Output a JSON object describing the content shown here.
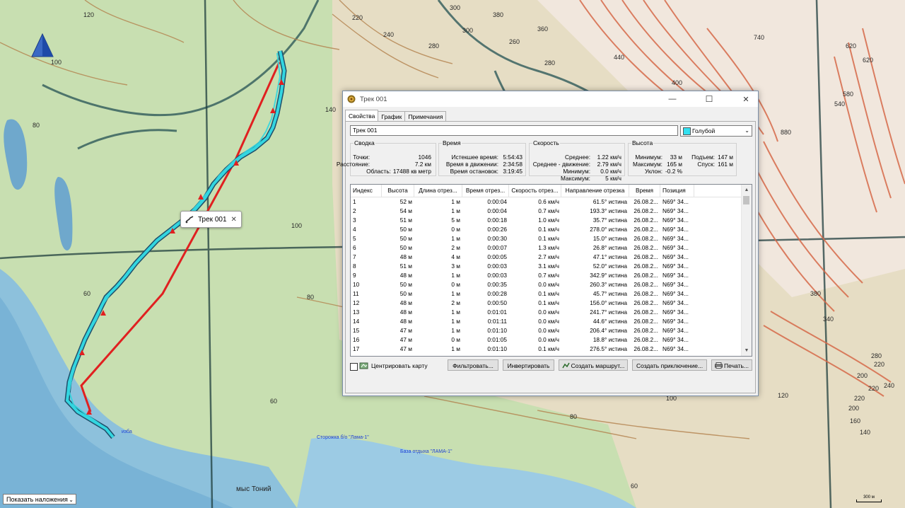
{
  "map": {
    "contour_labels": [
      "120",
      "100",
      "80",
      "60",
      "100",
      "80",
      "60",
      "140",
      "380",
      "280",
      "300",
      "240",
      "220",
      "360",
      "300",
      "260",
      "280",
      "440",
      "400",
      "740",
      "620",
      "620",
      "580",
      "880",
      "540",
      "380",
      "340",
      "280",
      "220",
      "200",
      "240",
      "220",
      "220",
      "200",
      "160",
      "140",
      "120",
      "100",
      "80",
      "60"
    ],
    "place_labels": [
      "изба",
      "Сторожка б/о \"Лама-1\"",
      "База отдыха \"ЛАМА-1\"",
      "мыс Тоний"
    ],
    "scale_label": "300 м",
    "overlay_dropdown": "Показать наложения",
    "track_popup_label": "Трек 001",
    "track_color": "#33d6e0",
    "route_color": "#e02020"
  },
  "window": {
    "title": "Трек 001",
    "tabs": [
      "Свойства",
      "График",
      "Примечания"
    ],
    "name_value": "Трек 001",
    "color_value": "Голубой",
    "color_hex": "#33e0f0",
    "summary": {
      "title": "Сводка",
      "points_label": "Точки:",
      "points_value": "1046",
      "distance_label": "Расстояние:",
      "distance_value": "7.2 км",
      "area_label": "Область:",
      "area_value": "17488 кв метр"
    },
    "time": {
      "title": "Время",
      "elapsed_label": "Истекшее время:",
      "elapsed_value": "5:54:43",
      "moving_label": "Время в движении:",
      "moving_value": "2:34:58",
      "stopped_label": "Время остановок:",
      "stopped_value": "3:19:45"
    },
    "speed": {
      "title": "Скорость",
      "avg_label": "Среднее:",
      "avg_value": "1.22 км/ч",
      "avg_moving_label": "Среднее - движение:",
      "avg_moving_value": "2.79 км/ч",
      "min_label": "Минимум:",
      "min_value": "0.0 км/ч",
      "max_label": "Максимум:",
      "max_value": "5 км/ч"
    },
    "elevation": {
      "title": "Высота",
      "min_label": "Минимум:",
      "min_value": "33 м",
      "max_label": "Максимум:",
      "max_value": "165 м",
      "grade_label": "Уклон:",
      "grade_value": "-0.2 %",
      "ascent_label": "Подъем:",
      "ascent_value": "147 м",
      "descent_label": "Спуск:",
      "descent_value": "161 м"
    },
    "table": {
      "headers": [
        "Индекс",
        "Высота",
        "Длина отрез...",
        "Время отрез...",
        "Скорость отрез...",
        "Направление отрезка",
        "Время",
        "Позиция"
      ],
      "rows": [
        [
          "1",
          "52 м",
          "1 м",
          "0:00:04",
          "0.6 км/ч",
          "61.5° истина",
          "26.08.2...",
          "N69° 34..."
        ],
        [
          "2",
          "54 м",
          "1 м",
          "0:00:04",
          "0.7 км/ч",
          "193.3° истина",
          "26.08.2...",
          "N69° 34..."
        ],
        [
          "3",
          "51 м",
          "5 м",
          "0:00:18",
          "1.0 км/ч",
          "35.7° истина",
          "26.08.2...",
          "N69° 34..."
        ],
        [
          "4",
          "50 м",
          "0 м",
          "0:00:26",
          "0.1 км/ч",
          "278.0° истина",
          "26.08.2...",
          "N69° 34..."
        ],
        [
          "5",
          "50 м",
          "1 м",
          "0:00:30",
          "0.1 км/ч",
          "15.0° истина",
          "26.08.2...",
          "N69° 34..."
        ],
        [
          "6",
          "50 м",
          "2 м",
          "0:00:07",
          "1.3 км/ч",
          "26.8° истина",
          "26.08.2...",
          "N69° 34..."
        ],
        [
          "7",
          "48 м",
          "4 м",
          "0:00:05",
          "2.7 км/ч",
          "47.1° истина",
          "26.08.2...",
          "N69° 34..."
        ],
        [
          "8",
          "51 м",
          "3 м",
          "0:00:03",
          "3.1 км/ч",
          "52.0° истина",
          "26.08.2...",
          "N69° 34..."
        ],
        [
          "9",
          "48 м",
          "1 м",
          "0:00:03",
          "0.7 км/ч",
          "342.9° истина",
          "26.08.2...",
          "N69° 34..."
        ],
        [
          "10",
          "50 м",
          "0 м",
          "0:00:35",
          "0.0 км/ч",
          "260.3° истина",
          "26.08.2...",
          "N69° 34..."
        ],
        [
          "11",
          "50 м",
          "1 м",
          "0:00:28",
          "0.1 км/ч",
          "45.7° истина",
          "26.08.2...",
          "N69° 34..."
        ],
        [
          "12",
          "48 м",
          "2 м",
          "0:00:50",
          "0.1 км/ч",
          "156.0° истина",
          "26.08.2...",
          "N69° 34..."
        ],
        [
          "13",
          "48 м",
          "1 м",
          "0:01:01",
          "0.0 км/ч",
          "241.7° истина",
          "26.08.2...",
          "N69° 34..."
        ],
        [
          "14",
          "48 м",
          "1 м",
          "0:01:11",
          "0.0 км/ч",
          "44.6° истина",
          "26.08.2...",
          "N69° 34..."
        ],
        [
          "15",
          "47 м",
          "1 м",
          "0:01:10",
          "0.0 км/ч",
          "206.4° истина",
          "26.08.2...",
          "N69° 34..."
        ],
        [
          "16",
          "47 м",
          "0 м",
          "0:01:05",
          "0.0 км/ч",
          "18.8° истина",
          "26.08.2...",
          "N69° 34..."
        ],
        [
          "17",
          "47 м",
          "1 м",
          "0:01:10",
          "0.1 км/ч",
          "276.5° истина",
          "26.08.2...",
          "N69° 34..."
        ]
      ]
    },
    "center_map_label": "Центрировать карту",
    "buttons": {
      "filter": "Фильтровать...",
      "invert": "Инвертировать",
      "create_route": "Создать маршрут...",
      "create_adventure": "Создать приключение...",
      "print": "Печать..."
    }
  }
}
